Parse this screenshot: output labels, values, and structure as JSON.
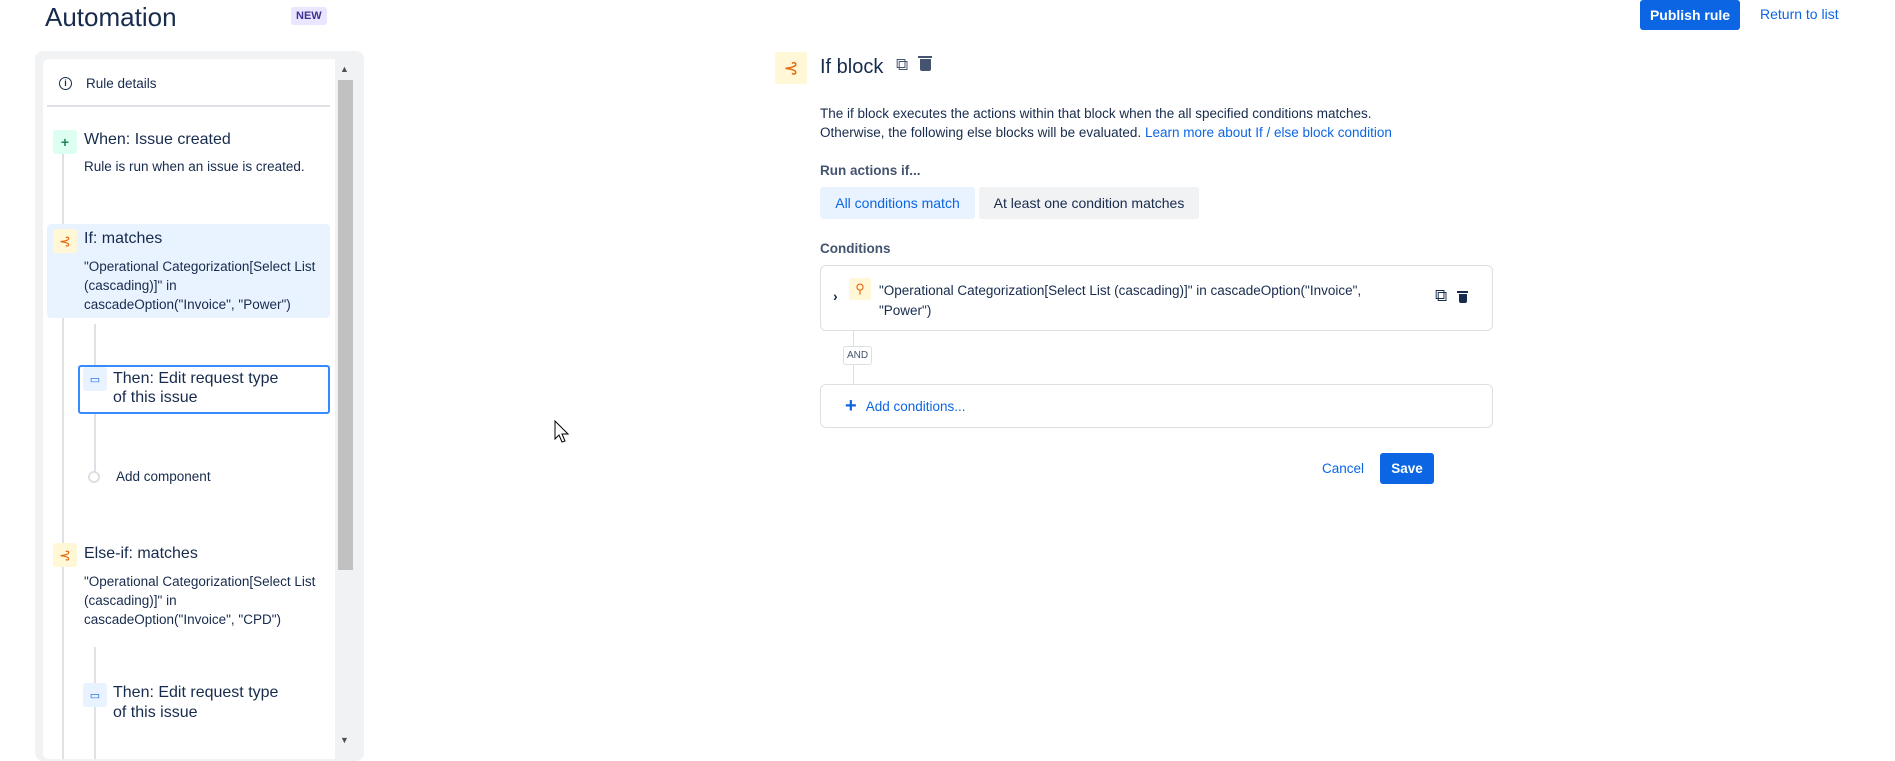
{
  "header": {
    "title": "Automation",
    "badge": "NEW",
    "publish": "Publish rule",
    "return": "Return to list"
  },
  "sidebar": {
    "rule_details": "Rule details",
    "trigger": {
      "title": "When: Issue created",
      "desc": "Rule is run when an issue is created."
    },
    "if": {
      "title": "If: matches",
      "desc": [
        "\"Operational Categorization[Select List",
        "(cascading)]\" in",
        "cascadeOption(\"Invoice\", \"Power\")"
      ]
    },
    "then1": {
      "title": [
        "Then: Edit request type",
        "of this issue"
      ]
    },
    "add_component": "Add component",
    "elseif": {
      "title": "Else-if: matches",
      "desc": [
        "\"Operational Categorization[Select List",
        "(cascading)]\" in",
        "cascadeOption(\"Invoice\", \"CPD\")"
      ]
    },
    "then2": {
      "title": [
        "Then: Edit request type",
        "of this issue"
      ]
    }
  },
  "main": {
    "title": "If block",
    "desc1": "The if block executes the actions within that block when the all specified conditions matches.",
    "desc2": "Otherwise, the following else blocks will be evaluated.",
    "learn_more": "Learn more about If / else block condition",
    "run_label": "Run actions if...",
    "options": [
      "All conditions match",
      "At least one condition matches"
    ],
    "selected_option": "All conditions match",
    "conditions_label": "Conditions",
    "condition": [
      "\"Operational Categorization[Select List (cascading)]\" in cascadeOption(\"Invoice\",",
      "\"Power\")"
    ],
    "and": "AND",
    "add_conditions": "Add conditions...",
    "cancel": "Cancel",
    "save": "Save"
  },
  "colors": {
    "accent": "#0c66e4",
    "if_icon_bg": "#fff7d6",
    "if_icon": "#e56910",
    "trigger_bg": "#dcfff1",
    "selected_bg": "#e9f2ff"
  }
}
